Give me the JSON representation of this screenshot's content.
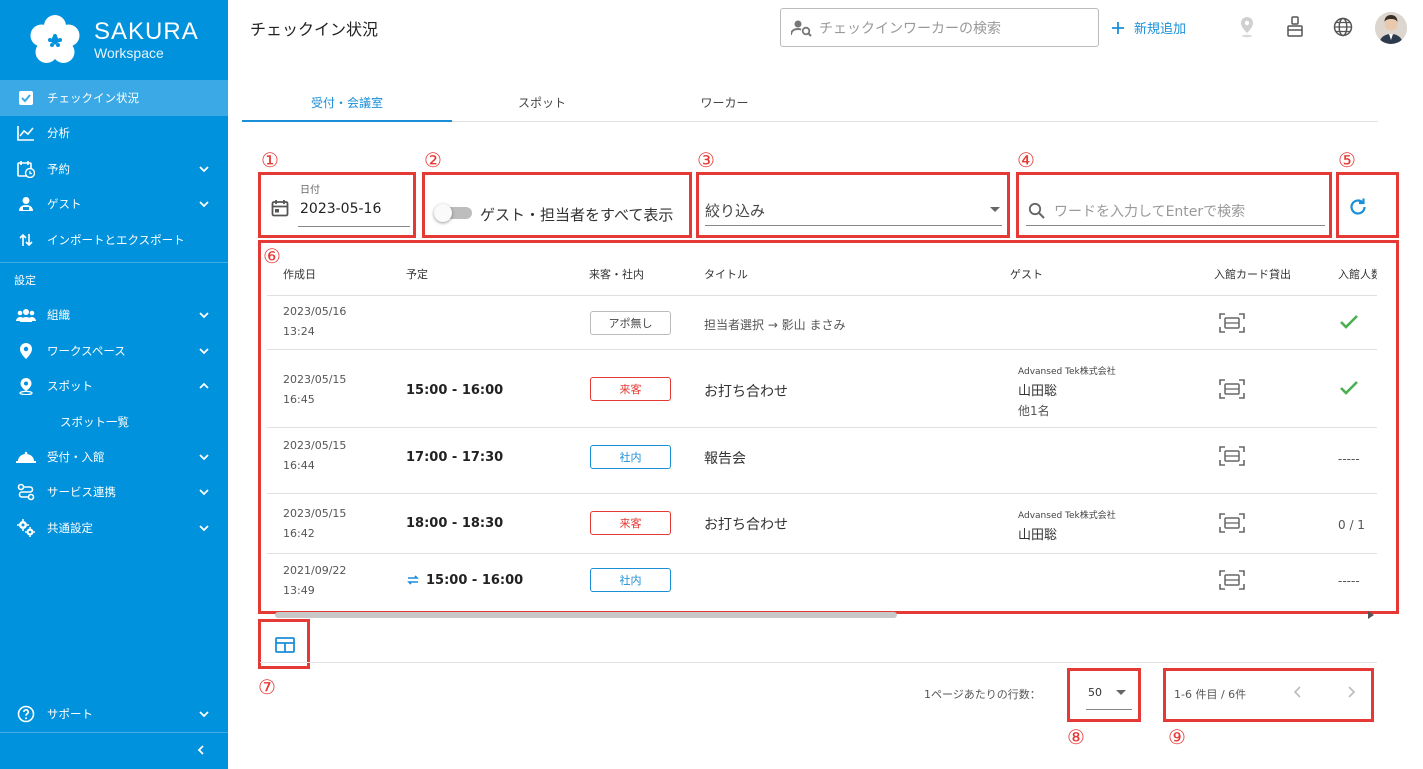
{
  "brand": {
    "name": "SAKURA",
    "sub": "Workspace"
  },
  "colors": {
    "sidebar": "#0092dc",
    "accent": "#1a8fd8",
    "callout": "#e53935",
    "check": "#4caf50"
  },
  "sidebar": {
    "items": [
      {
        "label": "チェックイン状況",
        "icon": "checkbox-icon",
        "active": true
      },
      {
        "label": "分析",
        "icon": "chart-icon"
      },
      {
        "label": "予約",
        "icon": "calendar-clock-icon",
        "expand": "down"
      },
      {
        "label": "ゲスト",
        "icon": "guest-icon",
        "expand": "down"
      },
      {
        "label": "インポートとエクスポート",
        "icon": "import-export-icon"
      }
    ],
    "section_label": "設定",
    "settings_items": [
      {
        "label": "組織",
        "icon": "people-icon",
        "expand": "down"
      },
      {
        "label": "ワークスペース",
        "icon": "location-pin-icon",
        "expand": "down"
      },
      {
        "label": "スポット",
        "icon": "spot-pin-icon",
        "expand": "up"
      }
    ],
    "sub_item": "スポット一覧",
    "more_items": [
      {
        "label": "受付・入館",
        "icon": "reception-bell-icon",
        "expand": "down"
      },
      {
        "label": "サービス連携",
        "icon": "route-icon",
        "expand": "down"
      },
      {
        "label": "共通設定",
        "icon": "gears-icon",
        "expand": "down"
      }
    ],
    "support": "サポート"
  },
  "header": {
    "title": "チェックイン状況",
    "search_placeholder": "チェックインワーカーの検索",
    "add_new": "新規追加"
  },
  "tabs": [
    "受付・会議室",
    "スポット",
    "ワーカー"
  ],
  "callouts": [
    "①",
    "②",
    "③",
    "④",
    "⑤",
    "⑥",
    "⑦",
    "⑧",
    "⑨"
  ],
  "filters": {
    "date_label": "日付",
    "date_value": "2023-05-16",
    "toggle_label": "ゲスト・担当者をすべて表示",
    "toggle_on": false,
    "select_label": "絞り込み",
    "search_placeholder": "ワードを入力してEnterで検索"
  },
  "table": {
    "columns": [
      "作成日",
      "予定",
      "来客・社内",
      "タイトル",
      "ゲスト",
      "入館カード貸出",
      "入館人数"
    ],
    "rows": [
      {
        "created_date": "2023/05/16",
        "created_time": "13:24",
        "time": "",
        "badge": "アポ無し",
        "badge_type": "none",
        "title": "担当者選択 → 影山 まさみ",
        "guest_company": "",
        "guest_name": "",
        "guest_more": "",
        "entry": "check"
      },
      {
        "created_date": "2023/05/15",
        "created_time": "16:45",
        "time": "15:00 - 16:00",
        "badge": "来客",
        "badge_type": "visit",
        "title": "お打ち合わせ",
        "guest_company": "Advansed Tek株式会社",
        "guest_name": "山田聡",
        "guest_more": "他1名",
        "entry": "check"
      },
      {
        "created_date": "2023/05/15",
        "created_time": "16:44",
        "time": "17:00 - 17:30",
        "badge": "社内",
        "badge_type": "internal",
        "title": "報告会",
        "guest_company": "",
        "guest_name": "",
        "guest_more": "",
        "entry": "-----"
      },
      {
        "created_date": "2023/05/15",
        "created_time": "16:42",
        "time": "18:00 - 18:30",
        "badge": "来客",
        "badge_type": "visit",
        "title": "お打ち合わせ",
        "guest_company": "Advansed Tek株式会社",
        "guest_name": "山田聡",
        "guest_more": "",
        "entry": "0 / 1"
      },
      {
        "created_date": "2021/09/22",
        "created_time": "13:49",
        "time": "15:00 - 16:00",
        "recurring": true,
        "badge": "社内",
        "badge_type": "internal",
        "title": "",
        "guest_company": "",
        "guest_name": "",
        "guest_more": "",
        "entry": "-----"
      }
    ]
  },
  "footer": {
    "rows_per_page_label": "1ページあたりの行数：",
    "rows_per_page": "50",
    "page_info": "1-6 件目 / 6件"
  }
}
